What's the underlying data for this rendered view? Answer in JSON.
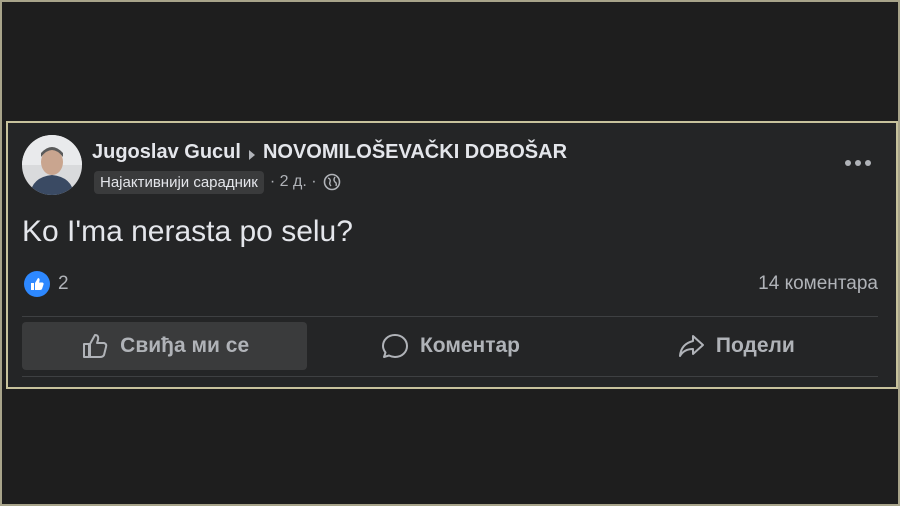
{
  "post": {
    "author": "Jugoslav Gucul",
    "group": "NOVOMILOŠEVAČKI DOBOŠAR",
    "badge": "Најактивнији сарадник",
    "time": "· 2 д. ·",
    "text": "Ko I'ma nerasta po selu?",
    "reaction_count": "2",
    "comment_count": "14 коментара"
  },
  "actions": {
    "like_label": "Свиђа ми се",
    "comment_label": "Коментар",
    "share_label": "Подели"
  },
  "colors": {
    "accent": "#2d88ff",
    "post_bg": "#242526",
    "text": "#e4e6eb",
    "muted": "#b0b3b8"
  },
  "icons": [
    "avatar",
    "arrow-right-icon",
    "globe-icon",
    "more-icon",
    "like-reaction-icon",
    "thumbs-up-icon",
    "comment-icon",
    "share-icon"
  ]
}
